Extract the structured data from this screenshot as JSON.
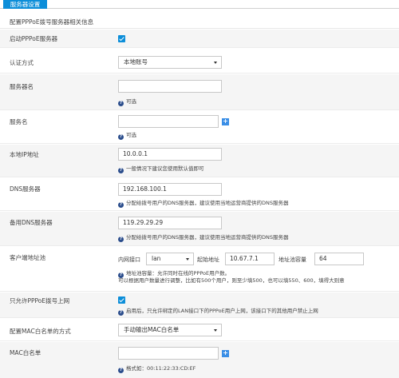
{
  "tab": {
    "label": "服务器设置"
  },
  "section_description": "配置PPPoE拨号服务器相关信息",
  "rows": {
    "enable": {
      "label": "启动PPPoE服务器",
      "checked": true
    },
    "auth": {
      "label": "认证方式",
      "value": "本地账号"
    },
    "server_name": {
      "label": "服务器名",
      "value": "",
      "help": "可选"
    },
    "service_name": {
      "label": "服务名",
      "value": "",
      "help": "可选"
    },
    "local_ip": {
      "label": "本地IP地址",
      "value": "10.0.0.1",
      "help": "一般情况下建议您使用默认值即可"
    },
    "dns": {
      "label": "DNS服务器",
      "value": "192.168.100.1",
      "help": "分配给拨号用户的DNS服务器，建议使用当地运营商提供的DNS服务器"
    },
    "dns2": {
      "label": "备用DNS服务器",
      "value": "119.29.29.29",
      "help": "分配给拨号用户的DNS服务器，建议使用当地运营商提供的DNS服务器"
    },
    "client_addr": {
      "label": "客户端地址池",
      "iface_label": "内网接口",
      "iface_value": "lan",
      "start_label": "起始地址",
      "start_value": "10.67.7.1",
      "capacity_label": "地址池容量",
      "capacity_value": "64",
      "help_line1": "地址池容量：允许同时在线的PPPoE用户数。",
      "help_line2": "可以根据用户数量进行调整，比如有500个用户，则至少填500，也可以填550、600，填得大则意"
    },
    "lan_only": {
      "label": "只允许PPPoE拨号上网",
      "checked": true,
      "help": "启用后，只允许绑定的LAN接口下的PPPoE用户上网，该接口下的其他用户禁止上网"
    },
    "mac_mode": {
      "label": "配置MAC白名单的方式",
      "value": "手动输出MAC白名单"
    },
    "mac_list": {
      "label": "MAC白名单",
      "value": "",
      "help": "格式如：00:11:22:33:CD:EF"
    }
  },
  "colors": {
    "accent": "#0c8ed9",
    "plus": "#3a8ee6",
    "help_icon": "#2b4d8c"
  },
  "icons": {
    "checkbox": "check-icon",
    "select": "chevron-down-icon",
    "add": "plus-icon",
    "help": "question-icon"
  }
}
